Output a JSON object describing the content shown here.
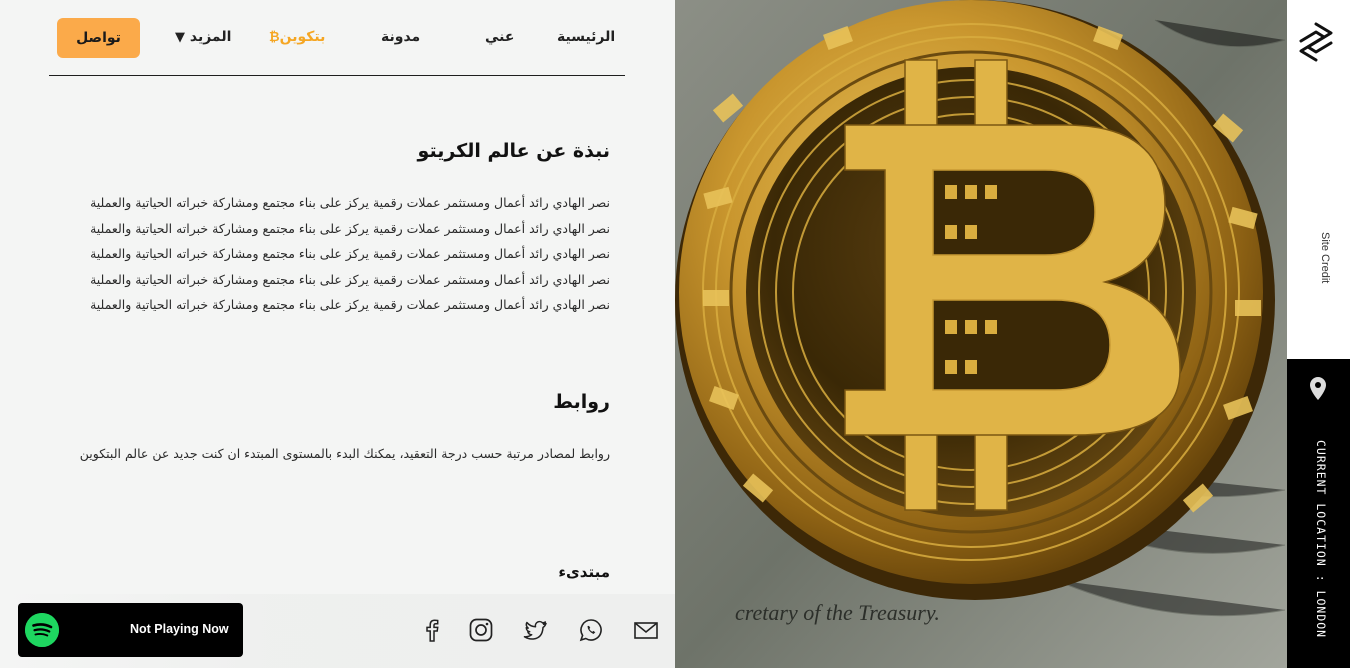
{
  "nav": {
    "home": "الرئيسية",
    "about": "عني",
    "blog": "مدونة",
    "bitcoin": "بتكوين",
    "bitcoin_icon": "bitcoin-icon",
    "more": "المزيد",
    "more_icon": "caret-down-icon",
    "contact": "تواصل"
  },
  "main": {
    "crypto_title": "نبذة عن عالم الكريتو",
    "crypto_body": "نصر الهادي رائد أعمال ومستثمر عملات رقمية يركز على بناء مجتمع ومشاركة خبراته الحياتية والعملية نصر الهادي رائد أعمال ومستثمر عملات رقمية يركز على بناء مجتمع ومشاركة خبراته الحياتية والعملية نصر الهادي رائد أعمال ومستثمر عملات رقمية يركز على بناء مجتمع ومشاركة خبراته الحياتية والعملية نصر الهادي رائد أعمال ومستثمر عملات رقمية يركز على بناء مجتمع ومشاركة خبراته الحياتية والعملية نصر الهادي رائد أعمال ومستثمر عملات رقمية يركز على بناء مجتمع ومشاركة خبراته الحياتية والعملية",
    "links_title": "روابط",
    "links_body": "روابط لمصادر مرتبة حسب درجة التعقيد، يمكنك البدء بالمستوى المبتدء ان كنت جديد عن عالم البتكوين",
    "beginner_label": "مبتدىء"
  },
  "social": [
    "email-icon",
    "whatsapp-icon",
    "twitter-icon",
    "instagram-icon",
    "facebook-icon"
  ],
  "player": {
    "icon": "spotify-icon",
    "status": "Not Playing Now"
  },
  "rail": {
    "logo_icon": "site-logo-icon",
    "credit": "Site Credit",
    "pin_icon": "location-pin-icon",
    "location": "CURRENT LOCATION : LONDON"
  },
  "colors": {
    "accent": "#fbaa4a",
    "active_nav": "#f5a623",
    "spotify": "#1ed760",
    "rail_dark": "#000000"
  }
}
